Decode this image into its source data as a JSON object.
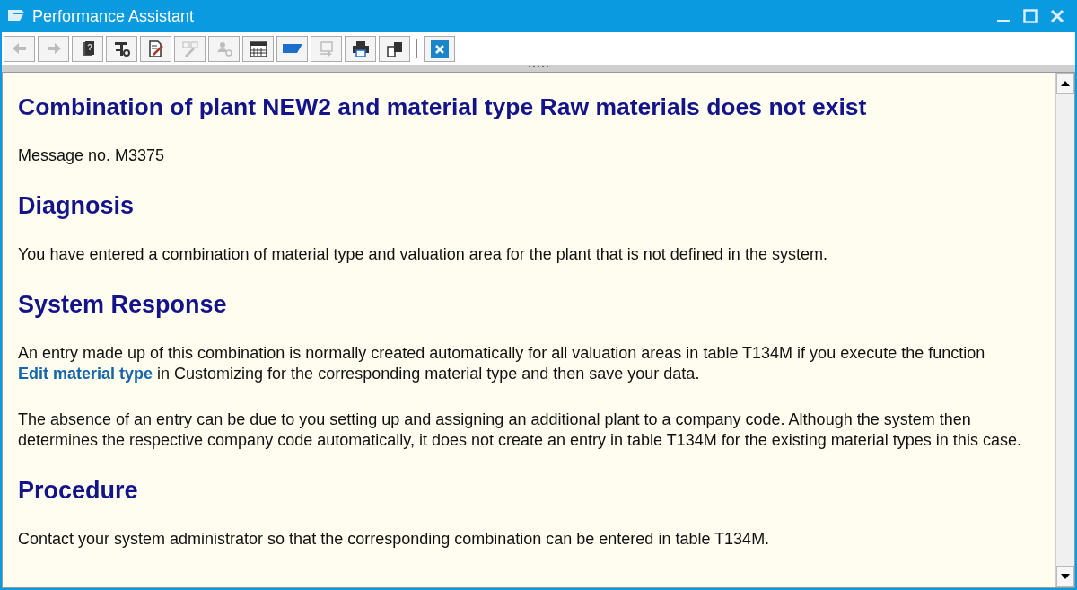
{
  "window": {
    "title": "Performance Assistant"
  },
  "toolbar": [
    {
      "kind": "back",
      "disabled": true
    },
    {
      "kind": "forward",
      "disabled": true
    },
    {
      "kind": "help-book",
      "disabled": false
    },
    {
      "kind": "tools",
      "disabled": false
    },
    {
      "kind": "edit-doc",
      "disabled": false
    },
    {
      "kind": "pen-doc",
      "disabled": true
    },
    {
      "kind": "user-key",
      "disabled": true
    },
    {
      "kind": "calendar",
      "disabled": false
    },
    {
      "kind": "flag",
      "disabled": false
    },
    {
      "kind": "export",
      "disabled": true
    },
    {
      "kind": "print",
      "disabled": false
    },
    {
      "kind": "find",
      "disabled": false
    },
    {
      "kind": "separator"
    },
    {
      "kind": "close",
      "disabled": false
    }
  ],
  "content": [
    {
      "kind": "title",
      "text": "Combination of plant NEW2 and material type Raw materials does not exist"
    },
    {
      "kind": "text",
      "text": "Message no. M3375"
    },
    {
      "kind": "heading",
      "text": "Diagnosis"
    },
    {
      "kind": "text",
      "text": "You have entered a combination of material type and valuation area for the plant that is not defined in the system."
    },
    {
      "kind": "heading",
      "text": "System Response"
    },
    {
      "kind": "link-text",
      "before": "An entry made up of this combination is normally created automatically for all valuation areas in table T134M if you execute the function ",
      "link": "Edit material type",
      "after": " in Customizing for the corresponding material type and then save your data."
    },
    {
      "kind": "text",
      "text": "The absence of an entry can be due to you setting up and assigning an additional plant to a company code. Although the system then determines the respective company code automatically, it does not create an entry in table T134M for the existing material types in this case."
    },
    {
      "kind": "heading",
      "text": "Procedure"
    },
    {
      "kind": "text",
      "text": "Contact your system administrator so that the corresponding combination can be entered in table T134M."
    }
  ]
}
